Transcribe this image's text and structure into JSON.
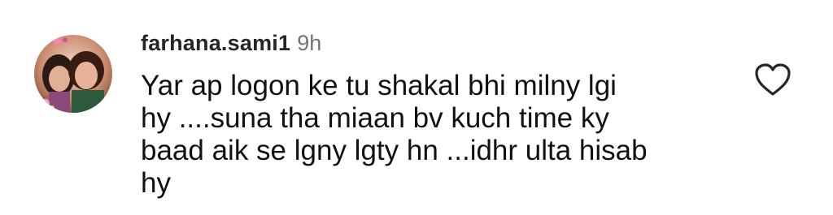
{
  "comment": {
    "username": "farhana.sami1",
    "time": "9h",
    "text_lines": [
      "Yar ap logon ke tu shakal bhi milny lgi",
      "hy ....suna tha miaan bv kuch time ky",
      "baad aik se lgny lgty hn ...idhr ulta hisab",
      "hy"
    ],
    "like_icon": "heart-outline-icon"
  },
  "colors": {
    "username": "#262626",
    "time": "#737373",
    "text": "#111111",
    "icon": "#262626"
  }
}
